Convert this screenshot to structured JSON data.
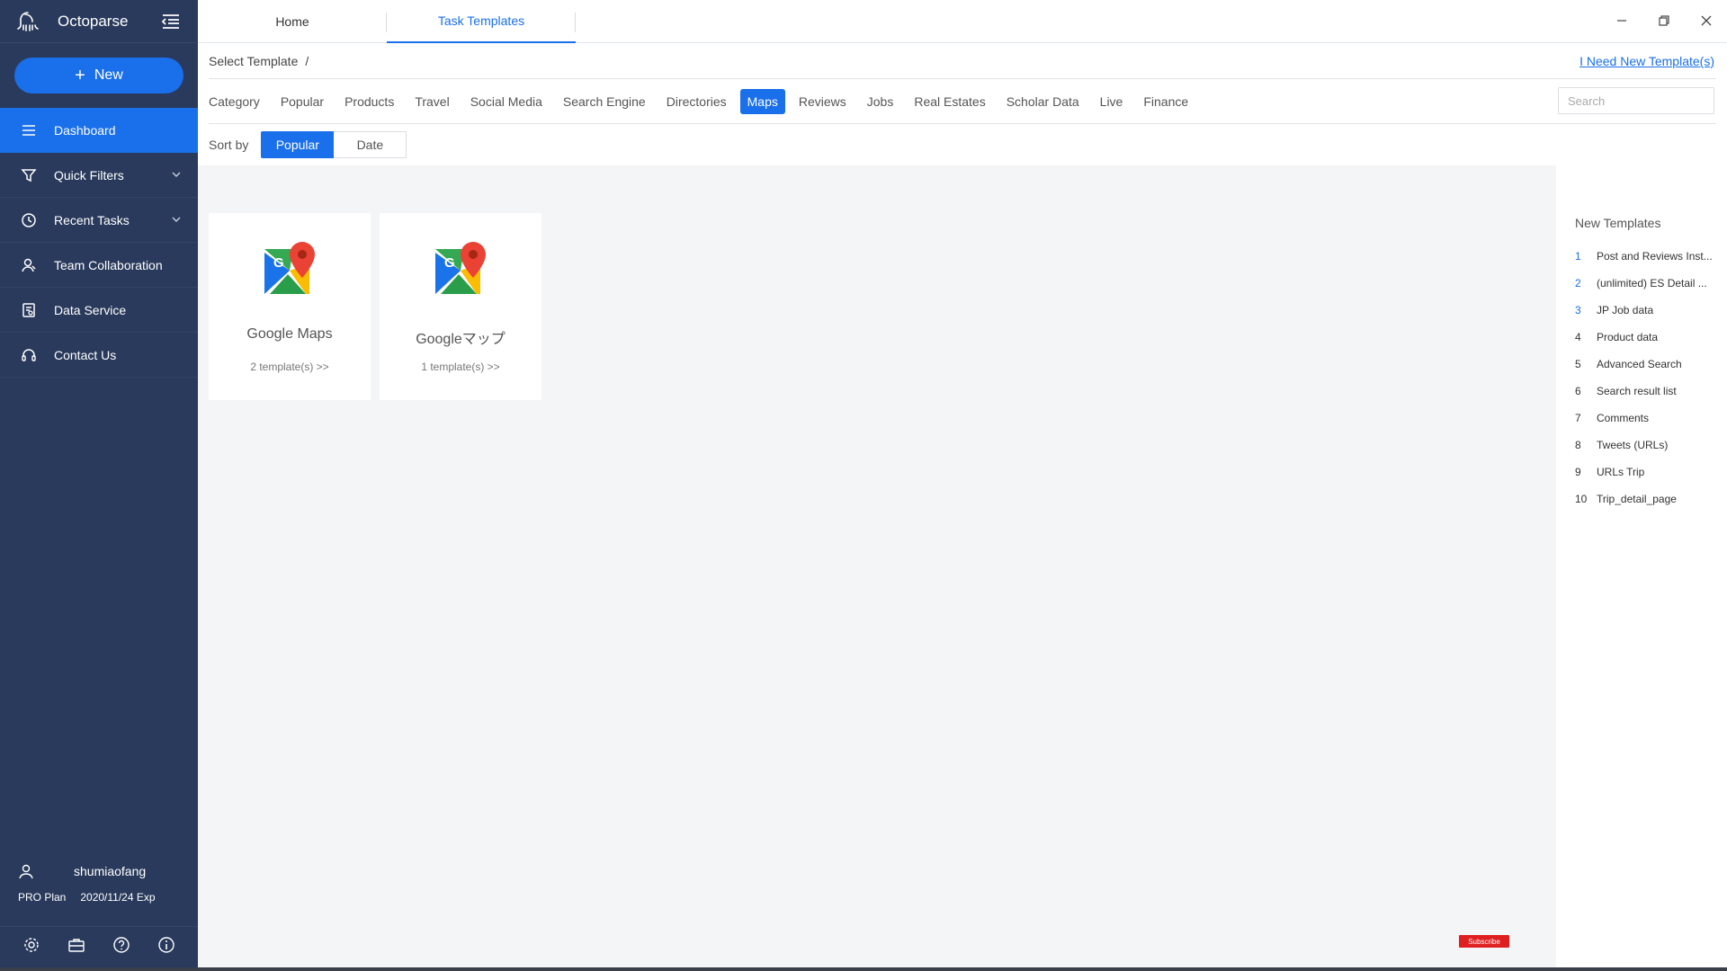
{
  "app": {
    "name": "Octoparse"
  },
  "sidebar": {
    "new_label": "New",
    "items": [
      {
        "label": "Dashboard",
        "icon": "list-icon"
      },
      {
        "label": "Quick Filters",
        "icon": "filter-icon"
      },
      {
        "label": "Recent Tasks",
        "icon": "clock-icon"
      },
      {
        "label": "Team Collaboration",
        "icon": "team-icon"
      },
      {
        "label": "Data Service",
        "icon": "document-icon"
      },
      {
        "label": "Contact Us",
        "icon": "headset-icon"
      }
    ],
    "user": {
      "name": "shumiaofang",
      "plan": "PRO Plan",
      "expiry": "2020/11/24 Exp"
    }
  },
  "tabs": {
    "home": "Home",
    "templates": "Task Templates"
  },
  "breadcrumb": {
    "root": "Select Template",
    "separator": "/"
  },
  "need_link": "I Need New Template(s)",
  "categories": {
    "label": "Category",
    "items": [
      "Popular",
      "Products",
      "Travel",
      "Social Media",
      "Search Engine",
      "Directories",
      "Maps",
      "Reviews",
      "Jobs",
      "Real Estates",
      "Scholar Data",
      "Live",
      "Finance"
    ],
    "active": "Maps"
  },
  "search": {
    "placeholder": "Search"
  },
  "sort": {
    "label": "Sort by",
    "options": [
      "Popular",
      "Date"
    ],
    "active": "Popular"
  },
  "cards": [
    {
      "title": "Google Maps",
      "count": "2 template(s) >>"
    },
    {
      "title": "Googleマップ",
      "count": "1 template(s) >>"
    }
  ],
  "new_templates": {
    "heading": "New Templates",
    "items": [
      {
        "num": "1",
        "label": "Post and Reviews Inst..."
      },
      {
        "num": "2",
        "label": "(unlimited) ES Detail ..."
      },
      {
        "num": "3",
        "label": "JP Job data"
      },
      {
        "num": "4",
        "label": "Product data"
      },
      {
        "num": "5",
        "label": "Advanced Search"
      },
      {
        "num": "6",
        "label": "Search result list"
      },
      {
        "num": "7",
        "label": "Comments"
      },
      {
        "num": "8",
        "label": "Tweets (URLs)"
      },
      {
        "num": "9",
        "label": "URLs Trip"
      },
      {
        "num": "10",
        "label": "Trip_detail_page"
      }
    ]
  },
  "subscribe_label": "Subscribe",
  "colors": {
    "sidebar": "#2a3a5c",
    "accent": "#1a6fea"
  }
}
